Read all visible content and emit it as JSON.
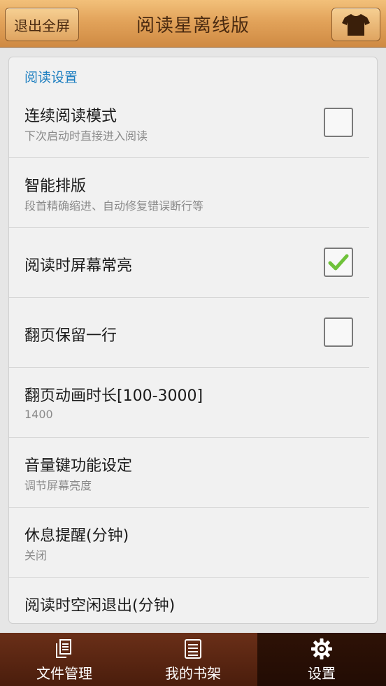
{
  "header": {
    "exit_label": "退出全屏",
    "title": "阅读星离线版",
    "skin_icon": "shirt-icon"
  },
  "settings": {
    "section_title": "阅读设置",
    "items": [
      {
        "title": "连续阅读模式",
        "subtitle": "下次启动时直接进入阅读",
        "control": "checkbox",
        "checked": false
      },
      {
        "title": "智能排版",
        "subtitle": "段首精确缩进、自动修复错误断行等",
        "control": "none"
      },
      {
        "title": "阅读时屏幕常亮",
        "subtitle": "",
        "control": "checkbox",
        "checked": true
      },
      {
        "title": "翻页保留一行",
        "subtitle": "",
        "control": "checkbox",
        "checked": false
      },
      {
        "title": "翻页动画时长[100-3000]",
        "subtitle": "1400",
        "control": "none"
      },
      {
        "title": "音量键功能设定",
        "subtitle": "调节屏幕亮度",
        "control": "none"
      },
      {
        "title": "休息提醒(分钟)",
        "subtitle": "关闭",
        "control": "none"
      },
      {
        "title": "阅读时空闲退出(分钟)",
        "subtitle": "",
        "control": "none"
      }
    ]
  },
  "nav": {
    "items": [
      {
        "label": "文件管理",
        "icon": "file-manage-icon",
        "active": false
      },
      {
        "label": "我的书架",
        "icon": "bookshelf-icon",
        "active": false
      },
      {
        "label": "设置",
        "icon": "gear-icon",
        "active": true
      }
    ]
  },
  "colors": {
    "header_accent": "#e2a35a",
    "section_title": "#1e7fc0",
    "check_mark": "#6fc23a",
    "nav_background": "#5a2612"
  }
}
